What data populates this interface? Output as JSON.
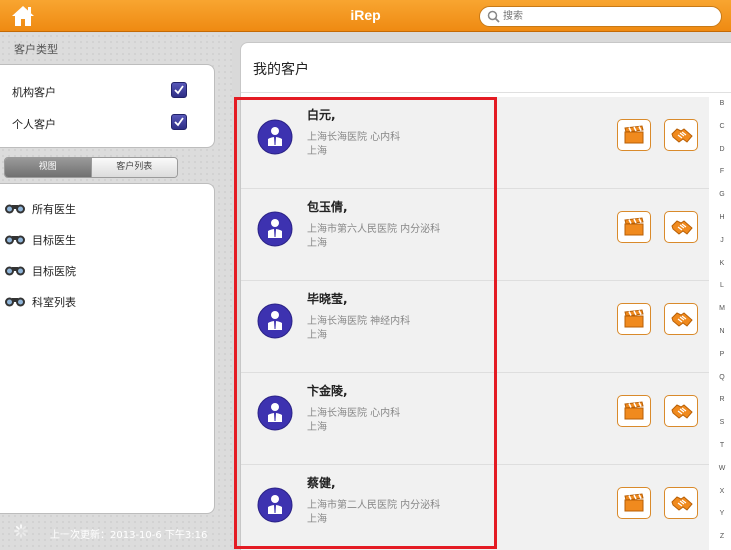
{
  "header": {
    "title": "iRep",
    "search_placeholder": "搜索"
  },
  "sidebar": {
    "filter_title": "客户类型",
    "filters": [
      {
        "label": "机构客户",
        "checked": true
      },
      {
        "label": "个人客户",
        "checked": true
      }
    ],
    "segments": [
      {
        "label": "视图",
        "active": true
      },
      {
        "label": "客户列表",
        "active": false
      }
    ],
    "nav": [
      {
        "label": "所有医生",
        "icon": "binoculars-icon"
      },
      {
        "label": "目标医生",
        "icon": "binoculars-icon"
      },
      {
        "label": "目标医院",
        "icon": "binoculars-icon"
      },
      {
        "label": "科室列表",
        "icon": "binoculars-icon"
      }
    ],
    "last_update": "上一次更新：2013-10-6 下午3:16"
  },
  "main": {
    "title": "我的客户",
    "customers": [
      {
        "name": "白元,",
        "hospital": "上海长海医院 心内科",
        "city": "上海"
      },
      {
        "name": "包玉倩,",
        "hospital": "上海市第六人民医院 内分泌科",
        "city": "上海"
      },
      {
        "name": "毕晓莹,",
        "hospital": "上海长海医院 神经内科",
        "city": "上海"
      },
      {
        "name": "卞金陵,",
        "hospital": "上海长海医院 心内科",
        "city": "上海"
      },
      {
        "name": "蔡健,",
        "hospital": "上海市第二人民医院 内分泌科",
        "city": "上海"
      }
    ],
    "alphabet": [
      "B",
      "C",
      "D",
      "F",
      "G",
      "H",
      "J",
      "K",
      "L",
      "M",
      "N",
      "P",
      "Q",
      "R",
      "S",
      "T",
      "W",
      "X",
      "Y",
      "Z"
    ]
  },
  "colors": {
    "header_orange": "#f39a22",
    "checkbox_purple": "#3a3a96",
    "avatar_purple": "#3d32b0",
    "action_orange": "#f08a1e",
    "highlight_red": "#e41b23"
  }
}
